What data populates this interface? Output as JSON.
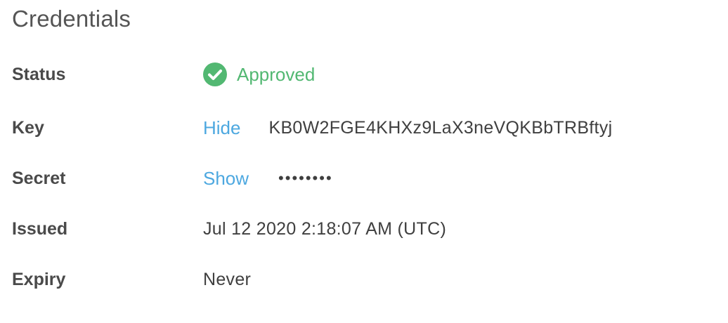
{
  "section_title": "Credentials",
  "rows": {
    "status": {
      "label": "Status",
      "value": "Approved",
      "color": "#52b872"
    },
    "key": {
      "label": "Key",
      "toggle_label": "Hide",
      "value": "KB0W2FGE4KHXz9LaX3neVQKBbTRBftyj"
    },
    "secret": {
      "label": "Secret",
      "toggle_label": "Show",
      "value": "••••••••"
    },
    "issued": {
      "label": "Issued",
      "value": "Jul 12 2020 2:18:07 AM (UTC)"
    },
    "expiry": {
      "label": "Expiry",
      "value": "Never"
    }
  },
  "icons": {
    "status_icon": "check-circle-icon"
  },
  "colors": {
    "link": "#4da8e0",
    "approved": "#52b872"
  }
}
